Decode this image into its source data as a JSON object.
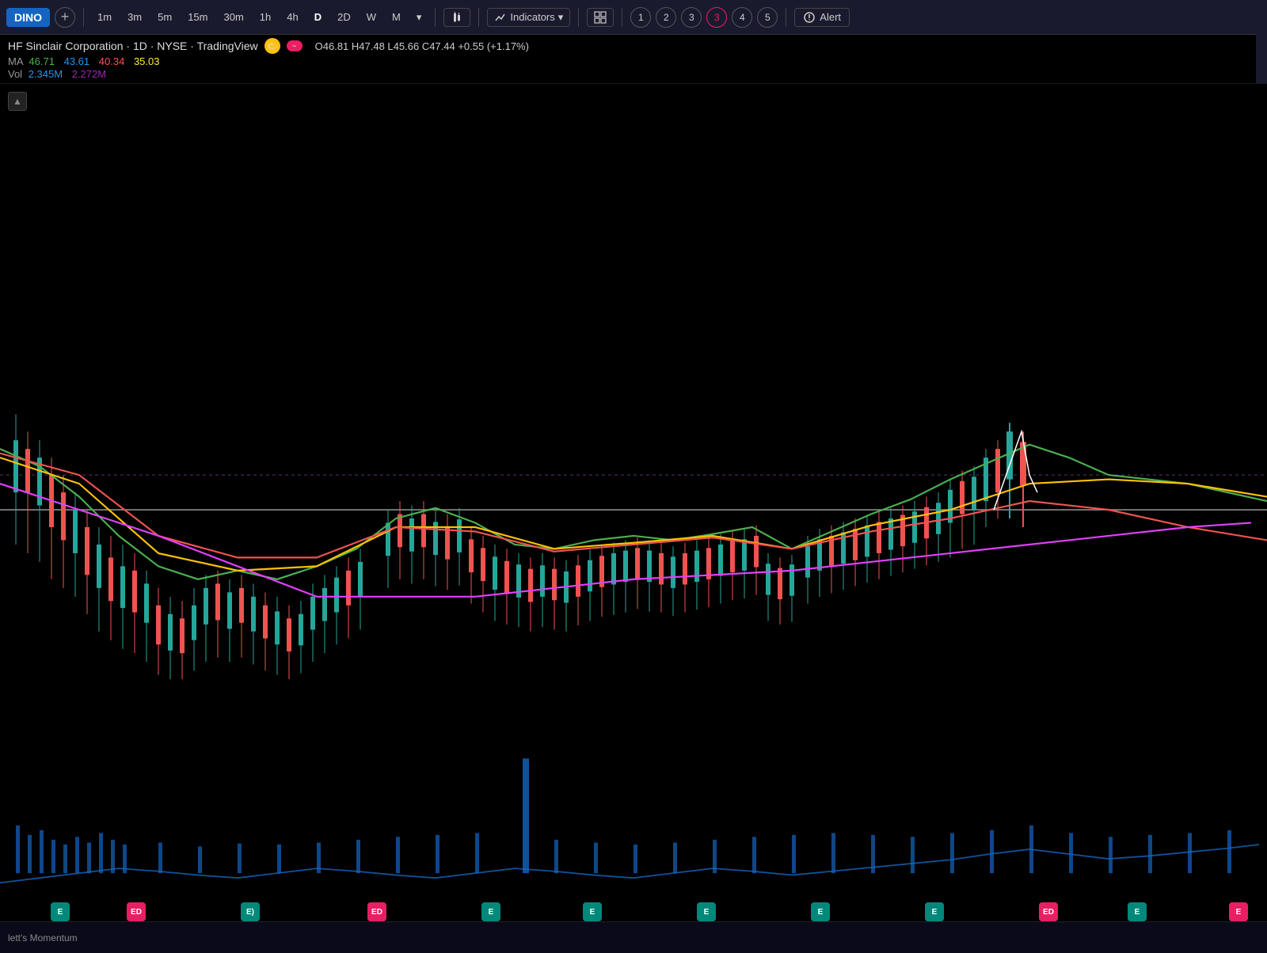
{
  "toolbar": {
    "symbol": "DINO",
    "add_label": "+",
    "timeframes": [
      "1m",
      "3m",
      "5m",
      "15m",
      "30m",
      "1h",
      "4h",
      "D",
      "2D",
      "W",
      "M"
    ],
    "active_timeframe": "D",
    "indicators_label": "Indicators",
    "chart_type_icon": "candlestick",
    "layout_icon": "layout",
    "circles": [
      "1",
      "2",
      "3",
      "3",
      "4",
      "5"
    ],
    "alert_label": "Alert"
  },
  "chart_info": {
    "title": "HF Sinclair Corporation · 1D · NYSE · TradingView",
    "ohlc": "O46.81 H47.48 L45.66 C47.44 +0.55 (+1.17%)",
    "ma_label": "MA",
    "ma_values": [
      {
        "value": "46.71",
        "color": "#4caf50"
      },
      {
        "value": "43.61",
        "color": "#2196f3"
      },
      {
        "value": "40.34",
        "color": "#ff5252"
      },
      {
        "value": "35.03",
        "color": "#ffeb3b"
      }
    ],
    "vol_label": "Vol",
    "vol_values": [
      "2.345M",
      "2.272M"
    ]
  },
  "bottom_bar": {
    "label": "lett's Momentum"
  },
  "event_badges": [
    {
      "type": "E",
      "left": "5%"
    },
    {
      "type": "ED",
      "left": "11%"
    },
    {
      "type": "E)",
      "left": "20%"
    },
    {
      "type": "ED",
      "left": "30%"
    },
    {
      "type": "E",
      "left": "40%"
    },
    {
      "type": "E",
      "left": "48%"
    },
    {
      "type": "E",
      "left": "57%"
    },
    {
      "type": "E",
      "left": "66%"
    },
    {
      "type": "E",
      "left": "75%"
    },
    {
      "type": "ED",
      "left": "85%"
    },
    {
      "type": "E",
      "left": "90%"
    },
    {
      "type": "E",
      "left": "97%"
    }
  ]
}
